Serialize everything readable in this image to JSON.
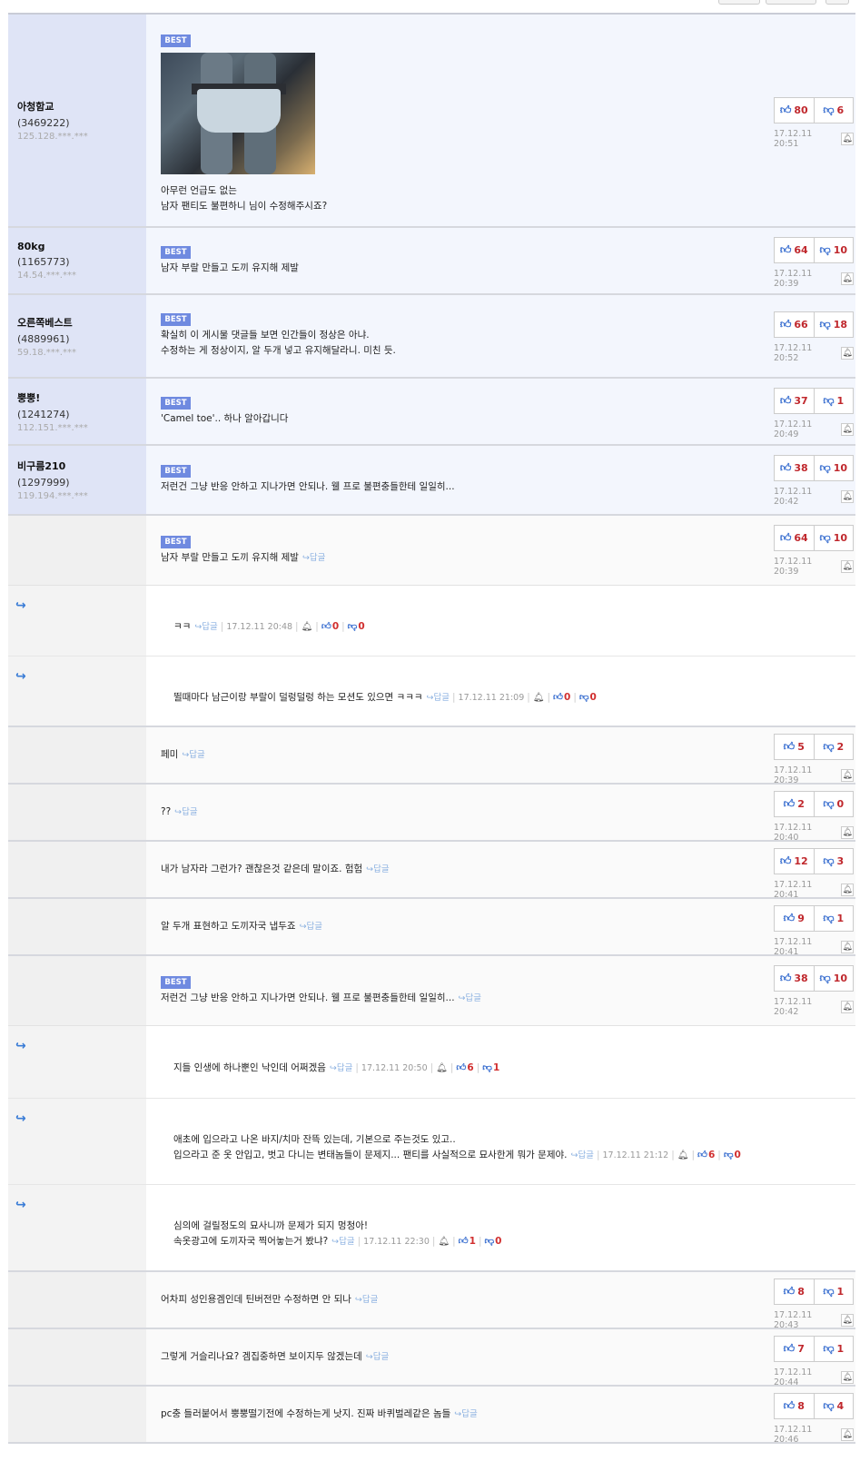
{
  "comments": [
    {
      "nick": "아청함교",
      "uid": "(3469222)",
      "ip": "125.128.***.***",
      "lines": [
        "아무런 언급도 없는",
        "남자 팬티도 불편하니 님이 수정해주시죠?"
      ],
      "up": "80",
      "down": "6",
      "date": "17.12.11 20:51"
    },
    {
      "nick": "80kg",
      "uid": "(1165773)",
      "ip": "14.54.***.***",
      "lines": [
        "남자 부랄 만들고 도끼 유지해 제발"
      ],
      "up": "64",
      "down": "10",
      "date": "17.12.11 20:39"
    },
    {
      "nick": "오른쪽베스트",
      "uid": "(4889961)",
      "ip": "59.18.***.***",
      "lines": [
        "확실히 이 게시물 댓글들 보면 인간들이 정상은 아냐.",
        "수정하는 게 정상이지, 알 두개 넣고 유지해달라니. 미친 듯."
      ],
      "up": "66",
      "down": "18",
      "date": "17.12.11 20:52"
    },
    {
      "nick": "뿡뿡!",
      "uid": "(1241274)",
      "ip": "112.151.***.***",
      "lines": [
        "'Camel toe'.. 하나 알아갑니다"
      ],
      "up": "37",
      "down": "1",
      "date": "17.12.11 20:49"
    },
    {
      "nick": "비구름210",
      "uid": "(1297999)",
      "ip": "119.194.***.***",
      "lines": [
        "저런건 그냥 반응 안하고 지나가면 안되나. 웰 프로 불편충들한테 일일히..."
      ],
      "up": "38",
      "down": "10",
      "date": "17.12.11 20:42"
    },
    {
      "lines": [
        "남자 부랄 만들고 도끼 유지해 제발"
      ],
      "up": "64",
      "down": "10",
      "date": "17.12.11 20:39"
    },
    {
      "lines": [
        "ㅋㅋ"
      ],
      "date": "17.12.11 20:48",
      "up": "0",
      "down": "0"
    },
    {
      "lines": [
        "뛸때마다 남근이랑 부랄이 덜렁덜렁 하는 모션도 있으면 ㅋㅋㅋ"
      ],
      "date": "17.12.11 21:09",
      "up": "0",
      "down": "0"
    },
    {
      "lines": [
        "페미"
      ],
      "up": "5",
      "down": "2",
      "date": "17.12.11 20:39"
    },
    {
      "lines": [
        "??"
      ],
      "up": "2",
      "down": "0",
      "date": "17.12.11 20:40"
    },
    {
      "lines": [
        "내가 남자라 그런가? 괜찮은것 같은데 말이죠. 험험"
      ],
      "up": "12",
      "down": "3",
      "date": "17.12.11 20:41"
    },
    {
      "lines": [
        "알 두개 표현하고 도끼자국 냅두죠"
      ],
      "up": "9",
      "down": "1",
      "date": "17.12.11 20:41"
    },
    {
      "lines": [
        "저런건 그냥 반응 안하고 지나가면 안되나. 웰 프로 불편충들한테 일일히..."
      ],
      "up": "38",
      "down": "10",
      "date": "17.12.11 20:42"
    },
    {
      "lines": [
        "지들 인생에 하나뿐인 낙인데 어쩌겠음"
      ],
      "date": "17.12.11 20:50",
      "up": "6",
      "down": "1"
    },
    {
      "lines": [
        "애초에 입으라고 나온 바지/치마 잔뜩 있는데, 기본으로 주는것도 있고..",
        "입으라고 준 옷 안입고, 벗고 다니는 변태놈들이 문제지... 팬티를 사실적으로 묘사한게 뭐가 문제야."
      ],
      "date": "17.12.11 21:12",
      "up": "6",
      "down": "0"
    },
    {
      "lines": [
        "심의에 걸릴정도의 묘사니까 문제가 되지 멍청아!",
        "속옷광고에 도끼자국 찍어놓는거 봤냐?"
      ],
      "date": "17.12.11 22:30",
      "up": "1",
      "down": "0"
    },
    {
      "lines": [
        "어차피 성인용겜인데 틴버전만 수정하면 안 되나"
      ],
      "up": "8",
      "down": "1",
      "date": "17.12.11 20:43"
    },
    {
      "lines": [
        "그렇게 거슬리나요? 겜집중하면 보이지두 않겠는데"
      ],
      "up": "7",
      "down": "1",
      "date": "17.12.11 20:44"
    },
    {
      "lines": [
        "pc충 들러붙어서 뿡뿡떨기전에 수정하는게 낫지. 진짜 바퀴벌레같은 놈들"
      ],
      "up": "8",
      "down": "4",
      "date": "17.12.11 20:46"
    }
  ],
  "labels": {
    "best": "BEST",
    "reply": "↪답글"
  }
}
